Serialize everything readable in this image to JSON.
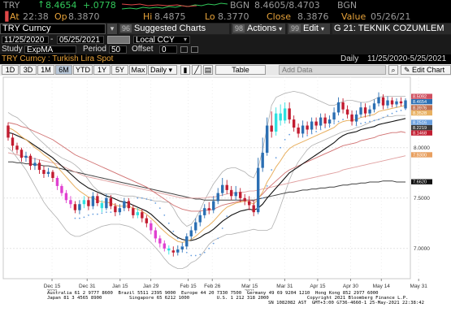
{
  "quote": {
    "ticker": "TRY",
    "last": "8.4654",
    "change": "+.0778",
    "bid_label": "BGN",
    "bid_ask": "8.4605/8.4703",
    "market_label": "BGN",
    "at_label": "At",
    "time": "22:38",
    "op_label": "Op",
    "open": "8.3870",
    "hi_label": "Hi",
    "high": "8.4875",
    "lo_label": "Lo",
    "low": "8.3770",
    "close_label": "Close",
    "close": "8.3876",
    "value_label": "Value",
    "value_date": "05/26/21"
  },
  "toolbar": {
    "security": "TRY Curncy",
    "suggested_charts": "Suggested Charts",
    "suggested_num": "96",
    "actions": "Actions",
    "actions_num": "98",
    "edit": "Edit",
    "edit_num": "99",
    "chart_name": "G 21: TEKNIK COZUMLEM"
  },
  "range": {
    "start": "11/25/2020",
    "end": "05/25/2021",
    "currency": "Local CCY",
    "frequency": "Daily",
    "range_text": "11/25/2020-5/25/2021"
  },
  "study": {
    "study_label": "Study",
    "study_value": "ExpMA",
    "period_label": "Period",
    "period_value": "50",
    "offset_label": "Offset",
    "offset_value": "0"
  },
  "subtitle": "TRY Curncy : Turkish Lira Spot",
  "periods": [
    "1D",
    "3D",
    "1M",
    "6M",
    "YTD",
    "1Y",
    "5Y",
    "Max"
  ],
  "active_period": "6M",
  "daily_dropdown": "Daily",
  "table_button": "Table",
  "add_data_placeholder": "Add Data",
  "edit_chart": "Edit Chart",
  "colors": {
    "up": "#2b6fb3",
    "down": "#c21c30",
    "cyan": "#2ee0e0",
    "magenta": "#e040d0",
    "ema_short": "#e8b060",
    "ema_mid": "#e0a0a0",
    "ema_long": "#111111",
    "ema_dark": "#3a3a3a",
    "bollinger": "#b0b0b0",
    "dots": "#6aa0e0"
  },
  "chart_data": {
    "type": "candlestick",
    "y_ticks": [
      7.0,
      7.5,
      8.0
    ],
    "y_tick_labels": [
      "7.0000",
      "7.5000",
      "8.0000"
    ],
    "ylim": [
      6.7,
      8.7
    ],
    "x_ticks": [
      {
        "label": "Dec 15",
        "date": "2020-12-15"
      },
      {
        "label": "Dec 31",
        "date": "2020-12-31"
      },
      {
        "label": "Jan 15",
        "date": "2021-01-15"
      },
      {
        "label": "Jan 29",
        "date": "2021-01-29"
      },
      {
        "label": "Feb 15",
        "date": "2021-02-15"
      },
      {
        "label": "Feb 26",
        "date": "2021-02-26"
      },
      {
        "label": "Mar 15",
        "date": "2021-03-15"
      },
      {
        "label": "Mar 31",
        "date": "2021-03-31"
      },
      {
        "label": "Apr 15",
        "date": "2021-04-15"
      },
      {
        "label": "Apr 30",
        "date": "2021-04-30"
      },
      {
        "label": "May 14",
        "date": "2021-05-14"
      },
      {
        "label": "May 31",
        "date": "2021-05-31"
      }
    ],
    "year_labels": [
      "2020",
      "2021"
    ],
    "price_labels": [
      {
        "value": "8.5092",
        "y": 8.5092,
        "color": "#d05060"
      },
      {
        "value": "8.4654",
        "y": 8.4654,
        "color": "#2b6fb3"
      },
      {
        "value": "8.3976",
        "y": 8.3976,
        "color": "#c07050"
      },
      {
        "value": "8.3528",
        "y": 8.3528,
        "color": "#e8b060"
      },
      {
        "value": "8.2516",
        "y": 8.2516,
        "color": "#6aa0e0"
      },
      {
        "value": "8.2219",
        "y": 8.2219,
        "color": "#3a3a3a"
      },
      {
        "value": "8.1468",
        "y": 8.1468,
        "color": "#c21c30"
      },
      {
        "value": "7.9300",
        "y": 7.93,
        "color": "#e8a060"
      },
      {
        "value": "7.6620",
        "y": 7.662,
        "color": "#111111"
      }
    ],
    "candles": [
      [
        8.22,
        8.1,
        8.25,
        8.07
      ],
      [
        8.1,
        8.02,
        8.14,
        7.97
      ],
      [
        8.02,
        7.98,
        8.05,
        7.94
      ],
      [
        7.98,
        7.9,
        8.0,
        7.86
      ],
      [
        7.9,
        7.92,
        7.96,
        7.86
      ],
      [
        7.92,
        7.82,
        7.94,
        7.78
      ],
      [
        7.82,
        7.85,
        7.9,
        7.78
      ],
      [
        7.85,
        7.78,
        7.88,
        7.74
      ],
      [
        7.78,
        7.74,
        7.82,
        7.7
      ],
      [
        7.74,
        7.76,
        7.8,
        7.71
      ],
      [
        7.76,
        7.7,
        7.78,
        7.66
      ],
      [
        7.7,
        7.62,
        7.72,
        7.58
      ],
      [
        7.62,
        7.55,
        7.64,
        7.52
      ],
      [
        7.55,
        7.48,
        7.58,
        7.45
      ],
      [
        7.48,
        7.44,
        7.52,
        7.4
      ],
      [
        7.44,
        7.38,
        7.47,
        7.35
      ],
      [
        7.38,
        7.44,
        7.48,
        7.34
      ],
      [
        7.44,
        7.48,
        7.52,
        7.4
      ],
      [
        7.48,
        7.42,
        7.51,
        7.38
      ],
      [
        7.42,
        7.52,
        7.56,
        7.39
      ],
      [
        7.52,
        7.45,
        7.55,
        7.42
      ],
      [
        7.45,
        7.4,
        7.48,
        7.36
      ],
      [
        7.4,
        7.5,
        7.54,
        7.38
      ],
      [
        7.5,
        7.42,
        7.53,
        7.39
      ],
      [
        7.42,
        7.36,
        7.45,
        7.32
      ],
      [
        7.36,
        7.4,
        7.44,
        7.33
      ],
      [
        7.4,
        7.47,
        7.5,
        7.37
      ],
      [
        7.47,
        7.4,
        7.5,
        7.37
      ],
      [
        7.4,
        7.33,
        7.43,
        7.3
      ],
      [
        7.33,
        7.36,
        7.4,
        7.3
      ],
      [
        7.36,
        7.3,
        7.39,
        7.26
      ],
      [
        7.3,
        7.25,
        7.33,
        7.21
      ],
      [
        7.25,
        7.18,
        7.28,
        7.14
      ],
      [
        7.18,
        7.1,
        7.21,
        7.06
      ],
      [
        7.1,
        7.05,
        7.13,
        7.01
      ],
      [
        7.05,
        7.0,
        7.08,
        6.97
      ],
      [
        7.0,
        6.98,
        7.03,
        6.94
      ],
      [
        6.98,
        6.96,
        7.02,
        6.92
      ],
      [
        6.96,
        6.99,
        7.03,
        6.93
      ],
      [
        6.99,
        7.02,
        7.06,
        6.96
      ],
      [
        7.02,
        7.12,
        7.15,
        6.99
      ],
      [
        7.12,
        7.18,
        7.22,
        7.09
      ],
      [
        7.18,
        7.26,
        7.3,
        7.15
      ],
      [
        7.26,
        7.33,
        7.37,
        7.22
      ],
      [
        7.33,
        7.4,
        7.44,
        7.3
      ],
      [
        7.4,
        7.38,
        7.46,
        7.34
      ],
      [
        7.38,
        7.47,
        7.52,
        7.35
      ],
      [
        7.47,
        7.55,
        7.6,
        7.44
      ],
      [
        7.55,
        7.63,
        7.7,
        7.52
      ],
      [
        7.63,
        7.58,
        7.68,
        7.54
      ],
      [
        7.58,
        7.52,
        7.62,
        7.48
      ],
      [
        7.52,
        7.56,
        7.62,
        7.48
      ],
      [
        7.56,
        7.5,
        7.6,
        7.46
      ],
      [
        7.5,
        7.47,
        7.54,
        7.43
      ],
      [
        7.47,
        7.43,
        7.52,
        7.38
      ],
      [
        7.43,
        7.36,
        7.47,
        7.32
      ],
      [
        7.36,
        7.8,
        7.9,
        7.34
      ],
      [
        7.8,
        7.95,
        8.1,
        7.76
      ],
      [
        7.95,
        8.22,
        8.3,
        7.92
      ],
      [
        8.22,
        8.16,
        8.36,
        8.1
      ],
      [
        8.16,
        8.34,
        8.4,
        8.12
      ],
      [
        8.34,
        8.27,
        8.43,
        8.22
      ],
      [
        8.27,
        8.39,
        8.45,
        8.24
      ],
      [
        8.39,
        8.28,
        8.45,
        8.24
      ],
      [
        8.28,
        8.2,
        8.32,
        8.16
      ],
      [
        8.2,
        8.14,
        8.24,
        8.1
      ],
      [
        8.14,
        8.22,
        8.27,
        8.1
      ],
      [
        8.22,
        8.18,
        8.26,
        8.13
      ],
      [
        8.18,
        8.26,
        8.3,
        8.14
      ],
      [
        8.26,
        8.22,
        8.3,
        8.18
      ],
      [
        8.22,
        8.3,
        8.34,
        8.18
      ],
      [
        8.3,
        8.24,
        8.34,
        8.2
      ],
      [
        8.24,
        8.28,
        8.32,
        8.2
      ],
      [
        8.28,
        8.35,
        8.4,
        8.25
      ],
      [
        8.35,
        8.45,
        8.5,
        8.32
      ],
      [
        8.45,
        8.38,
        8.49,
        8.34
      ],
      [
        8.38,
        8.33,
        8.42,
        8.29
      ],
      [
        8.33,
        8.26,
        8.37,
        8.22
      ],
      [
        8.26,
        8.33,
        8.37,
        8.22
      ],
      [
        8.33,
        8.4,
        8.45,
        8.3
      ],
      [
        8.4,
        8.34,
        8.44,
        8.3
      ],
      [
        8.34,
        8.38,
        8.42,
        8.31
      ],
      [
        8.38,
        8.44,
        8.48,
        8.35
      ],
      [
        8.44,
        8.5,
        8.55,
        8.41
      ],
      [
        8.5,
        8.42,
        8.53,
        8.38
      ],
      [
        8.42,
        8.47,
        8.51,
        8.39
      ],
      [
        8.47,
        8.43,
        8.5,
        8.4
      ],
      [
        8.43,
        8.46,
        8.49,
        8.4
      ],
      [
        8.46,
        8.44,
        8.5,
        8.41
      ],
      [
        8.39,
        8.47,
        8.49,
        8.38
      ]
    ],
    "highlight_cyan": [
      17,
      21,
      29,
      36,
      60,
      61,
      62
    ],
    "highlight_magenta": [
      11,
      12,
      13,
      14,
      32,
      33,
      34,
      35
    ],
    "ema_short": [
      8.2,
      8.18,
      8.15,
      8.11,
      8.08,
      8.04,
      8.0,
      7.97,
      7.93,
      7.9,
      7.86,
      7.81,
      7.76,
      7.71,
      7.66,
      7.61,
      7.57,
      7.54,
      7.51,
      7.5,
      7.48,
      7.46,
      7.46,
      7.45,
      7.43,
      7.42,
      7.42,
      7.42,
      7.4,
      7.39,
      7.37,
      7.34,
      7.3,
      7.26,
      7.21,
      7.17,
      7.13,
      7.1,
      7.07,
      7.06,
      7.07,
      7.09,
      7.12,
      7.16,
      7.2,
      7.23,
      7.27,
      7.32,
      7.37,
      7.41,
      7.43,
      7.45,
      7.46,
      7.47,
      7.46,
      7.44,
      7.49,
      7.56,
      7.66,
      7.73,
      7.81,
      7.87,
      7.94,
      7.99,
      8.02,
      8.04,
      8.06,
      8.08,
      8.1,
      8.12,
      8.14,
      8.16,
      8.18,
      8.2,
      8.24,
      8.26,
      8.27,
      8.27,
      8.28,
      8.3,
      8.31,
      8.32,
      8.33,
      8.36,
      8.37,
      8.38,
      8.39,
      8.4,
      8.41,
      8.42
    ],
    "ema_mid": [
      8.25,
      8.24,
      8.23,
      8.21,
      8.2,
      8.18,
      8.16,
      8.14,
      8.12,
      8.1,
      8.08,
      8.05,
      8.02,
      7.99,
      7.96,
      7.93,
      7.91,
      7.89,
      7.87,
      7.85,
      7.83,
      7.81,
      7.79,
      7.77,
      7.75,
      7.73,
      7.71,
      7.69,
      7.67,
      7.65,
      7.63,
      7.61,
      7.58,
      7.55,
      7.52,
      7.49,
      7.46,
      7.43,
      7.41,
      7.39,
      7.38,
      7.37,
      7.37,
      7.37,
      7.38,
      7.38,
      7.39,
      7.41,
      7.43,
      7.44,
      7.45,
      7.46,
      7.47,
      7.48,
      7.48,
      7.47,
      7.5,
      7.54,
      7.59,
      7.63,
      7.67,
      7.71,
      7.75,
      7.78,
      7.8,
      7.82,
      7.84,
      7.86,
      7.88,
      7.9,
      7.92,
      7.94,
      7.96,
      7.98,
      8.0,
      8.02,
      8.03,
      8.04,
      8.05,
      8.07,
      8.08,
      8.09,
      8.1,
      8.12,
      8.13,
      8.14,
      8.15,
      8.15,
      8.16,
      8.15
    ],
    "ema_long": [
      8.15,
      8.14,
      8.12,
      8.1,
      8.08,
      8.05,
      8.02,
      7.99,
      7.96,
      7.93,
      7.9,
      7.86,
      7.82,
      7.78,
      7.74,
      7.7,
      7.66,
      7.63,
      7.6,
      7.58,
      7.56,
      7.54,
      7.52,
      7.51,
      7.49,
      7.47,
      7.46,
      7.45,
      7.43,
      7.41,
      7.39,
      7.37,
      7.34,
      7.3,
      7.26,
      7.22,
      7.18,
      7.14,
      7.11,
      7.09,
      7.08,
      7.08,
      7.09,
      7.11,
      7.14,
      7.16,
      7.19,
      7.23,
      7.27,
      7.3,
      7.33,
      7.35,
      7.37,
      7.38,
      7.39,
      7.38,
      7.4,
      7.44,
      7.5,
      7.55,
      7.6,
      7.65,
      7.7,
      7.75,
      7.78,
      7.81,
      7.84,
      7.87,
      7.9,
      7.93,
      7.96,
      7.99,
      8.02,
      8.05,
      8.09,
      8.12,
      8.14,
      8.15,
      8.16,
      8.18,
      8.19,
      8.2,
      8.21,
      8.23,
      8.24,
      8.25,
      8.26,
      8.27,
      8.28,
      8.29
    ],
    "ema_200": [
      7.95,
      7.94,
      7.93,
      7.92,
      7.91,
      7.9,
      7.89,
      7.88,
      7.87,
      7.86,
      7.85,
      7.84,
      7.82,
      7.8,
      7.78,
      7.76,
      7.74,
      7.72,
      7.71,
      7.7,
      7.69,
      7.68,
      7.67,
      7.66,
      7.65,
      7.64,
      7.63,
      7.62,
      7.61,
      7.6,
      7.59,
      7.58,
      7.57,
      7.56,
      7.55,
      7.54,
      7.53,
      7.52,
      7.51,
      7.5,
      7.5,
      7.5,
      7.5,
      7.5,
      7.5,
      7.51,
      7.51,
      7.52,
      7.53,
      7.54,
      7.55,
      7.55,
      7.56,
      7.56,
      7.57,
      7.57,
      7.58,
      7.59,
      7.6,
      7.61,
      7.62,
      7.63,
      7.64,
      7.65,
      7.66,
      7.67,
      7.68,
      7.69,
      7.7,
      7.71,
      7.72,
      7.73,
      7.74,
      7.75,
      7.76,
      7.78,
      7.79,
      7.8,
      7.81,
      7.82,
      7.83,
      7.84,
      7.85,
      7.86,
      7.87,
      7.88,
      7.89,
      7.9,
      7.91,
      7.92
    ],
    "ema_long2": [
      7.86,
      7.86,
      7.85,
      7.85,
      7.84,
      7.84,
      7.83,
      7.83,
      7.82,
      7.82,
      7.81,
      7.8,
      7.79,
      7.78,
      7.77,
      7.76,
      7.75,
      7.74,
      7.73,
      7.72,
      7.71,
      7.7,
      7.69,
      7.68,
      7.67,
      7.66,
      7.65,
      7.64,
      7.63,
      7.62,
      7.61,
      7.6,
      7.59,
      7.58,
      7.57,
      7.56,
      7.55,
      7.54,
      7.53,
      7.52,
      7.51,
      7.5,
      7.49,
      7.49,
      7.48,
      7.48,
      7.48,
      7.48,
      7.48,
      7.48,
      7.48,
      7.48,
      7.48,
      7.48,
      7.48,
      7.48,
      7.49,
      7.5,
      7.51,
      7.52,
      7.53,
      7.54,
      7.55,
      7.56,
      7.56,
      7.57,
      7.58,
      7.58,
      7.59,
      7.59,
      7.6,
      7.6,
      7.61,
      7.61,
      7.62,
      7.63,
      7.63,
      7.64,
      7.64,
      7.65,
      7.65,
      7.66,
      7.66,
      7.66,
      7.67,
      7.67,
      7.67,
      7.66,
      7.66,
      7.66
    ],
    "bb_upper": [
      8.35,
      8.32,
      8.3,
      8.26,
      8.22,
      8.17,
      8.12,
      8.08,
      8.04,
      8.0,
      7.96,
      7.93,
      7.9,
      7.88,
      7.86,
      7.83,
      7.79,
      7.74,
      7.68,
      7.62,
      7.58,
      7.55,
      7.54,
      7.54,
      7.54,
      7.53,
      7.52,
      7.52,
      7.52,
      7.51,
      7.5,
      7.49,
      7.48,
      7.47,
      7.47,
      7.46,
      7.46,
      7.4,
      7.32,
      7.26,
      7.22,
      7.24,
      7.3,
      7.38,
      7.48,
      7.56,
      7.64,
      7.7,
      7.76,
      7.79,
      7.8,
      7.8,
      7.78,
      7.76,
      7.72,
      7.7,
      7.8,
      7.98,
      8.2,
      8.42,
      8.5,
      8.52,
      8.54,
      8.55,
      8.56,
      8.55,
      8.54,
      8.52,
      8.5,
      8.48,
      8.46,
      8.44,
      8.42,
      8.42,
      8.44,
      8.46,
      8.47,
      8.47,
      8.46,
      8.45,
      8.45,
      8.46,
      8.48,
      8.5,
      8.51,
      8.51,
      8.51,
      8.51,
      8.51,
      8.51
    ],
    "bb_lower": [
      8.0,
      7.96,
      7.9,
      7.84,
      7.78,
      7.7,
      7.62,
      7.54,
      7.46,
      7.4,
      7.35,
      7.3,
      7.24,
      7.18,
      7.14,
      7.12,
      7.12,
      7.14,
      7.16,
      7.18,
      7.2,
      7.22,
      7.23,
      7.24,
      7.24,
      7.24,
      7.23,
      7.22,
      7.2,
      7.17,
      7.14,
      7.1,
      7.06,
      7.01,
      6.96,
      6.9,
      6.85,
      6.82,
      6.8,
      6.8,
      6.82,
      6.86,
      6.88,
      6.92,
      6.98,
      7.04,
      7.08,
      7.1,
      7.12,
      7.14,
      7.14,
      7.15,
      7.16,
      7.17,
      7.18,
      7.19,
      7.18,
      7.18,
      7.18,
      7.2,
      7.3,
      7.42,
      7.55,
      7.68,
      7.78,
      7.86,
      7.92,
      7.98,
      8.02,
      8.04,
      8.06,
      8.08,
      8.1,
      8.12,
      8.14,
      8.16,
      8.17,
      8.18,
      8.2,
      8.21,
      8.23,
      8.25,
      8.27,
      8.28,
      8.3,
      8.31,
      8.31,
      8.32,
      8.32,
      8.32
    ],
    "psar": [
      null,
      null,
      null,
      null,
      null,
      null,
      null,
      null,
      null,
      null,
      null,
      null,
      null,
      null,
      null,
      7.3,
      7.3,
      7.31,
      7.33,
      7.34,
      7.34,
      7.35,
      7.36,
      7.36,
      null,
      null,
      null,
      null,
      null,
      7.5,
      7.5,
      7.49,
      7.48,
      7.45,
      7.4,
      7.33,
      7.25,
      7.17,
      7.1,
      7.02,
      6.96,
      6.93,
      6.93,
      6.94,
      6.96,
      7.0,
      7.05,
      7.1,
      7.2,
      7.32,
      null,
      null,
      null,
      null,
      null,
      null,
      7.4,
      7.5,
      7.62,
      7.78,
      7.9,
      8.0,
      8.08,
      8.13,
      null,
      null,
      null,
      8.12,
      8.14,
      8.16,
      8.18,
      8.2,
      8.22,
      8.24,
      8.26,
      8.28,
      null,
      null,
      8.22,
      8.24,
      8.25,
      8.26,
      8.27,
      8.28,
      8.3,
      8.32,
      8.34,
      8.36,
      8.37,
      8.38
    ]
  },
  "footer": {
    "line1": "Australia 61 2 9777 8600  Brazil 5511 2395 9000  Europe 44 20 7330 7500  Germany 49 69 9204 1210  Hong Kong 852 2977 6000",
    "line2": "Japan 81 3 4565 8900          Singapore 65 6212 1000          U.S. 1 212 318 2000              Copyright 2021 Bloomberg Finance L.P.",
    "line3": "SN 1082082 AST  GMT+3:00 G736-4660-1 25-May-2021 22:38:42"
  }
}
